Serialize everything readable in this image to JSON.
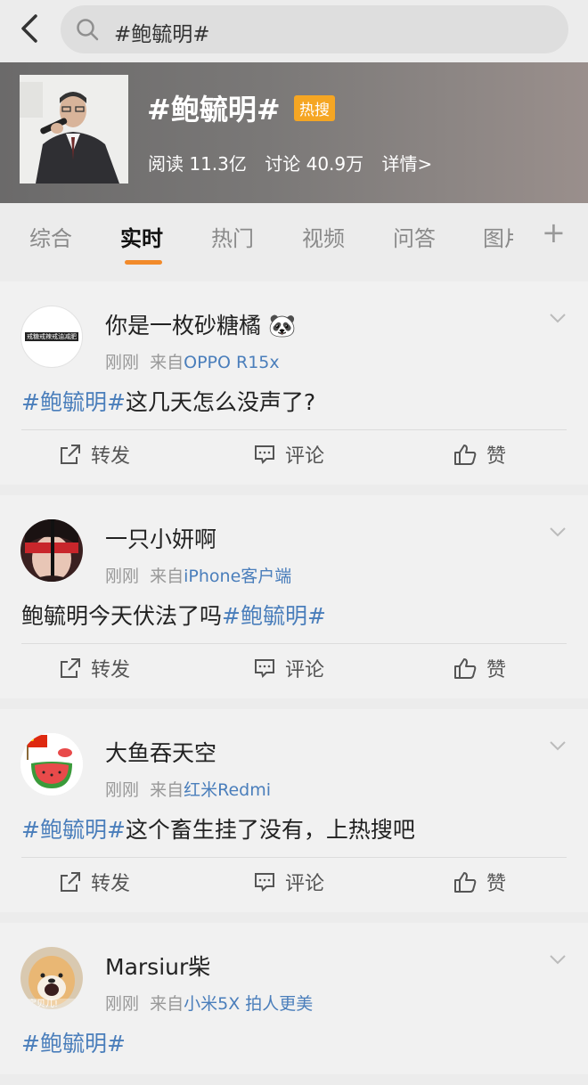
{
  "search": {
    "query": "#鲍毓明#"
  },
  "topic": {
    "title": "#鲍毓明#",
    "badge": "热搜",
    "reads": "阅读 11.3亿",
    "discussions": "讨论 40.9万",
    "details": "详情>"
  },
  "tabs": [
    "综合",
    "实时",
    "热门",
    "视频",
    "问答",
    "图片"
  ],
  "colors": {
    "accent": "#f28a2a",
    "link": "#4a7ebb",
    "badge": "#f5a623"
  },
  "posts": [
    {
      "name": "你是一枚砂糖橘 🐼",
      "time": "刚刚",
      "from": "来自",
      "source": "OPPO R15x",
      "text_tag_start": "#鲍毓明#",
      "text": "这几天怎么没声了?",
      "avatar_text": "戒糖戒辣戒油减肥"
    },
    {
      "name": "一只小妍啊",
      "time": "刚刚",
      "from": "来自",
      "source": "iPhone客户端",
      "text": "鲍毓明今天伏法了吗",
      "text_tag_end": "#鲍毓明#"
    },
    {
      "name": "大鱼吞天空",
      "time": "刚刚",
      "from": "来自",
      "source": "红米Redmi",
      "text_tag_start": "#鲍毓明#",
      "text": "这个畜生挂了没有，上热搜吧"
    },
    {
      "name": "Marsiur柴",
      "time": "刚刚",
      "from": "来自",
      "source": "小米5X 拍人更美",
      "text_tag_start": "#鲍毓明#",
      "avatar_text": "宝贝儿!"
    }
  ],
  "actions": {
    "repost": "转发",
    "comment": "评论",
    "like": "赞"
  }
}
